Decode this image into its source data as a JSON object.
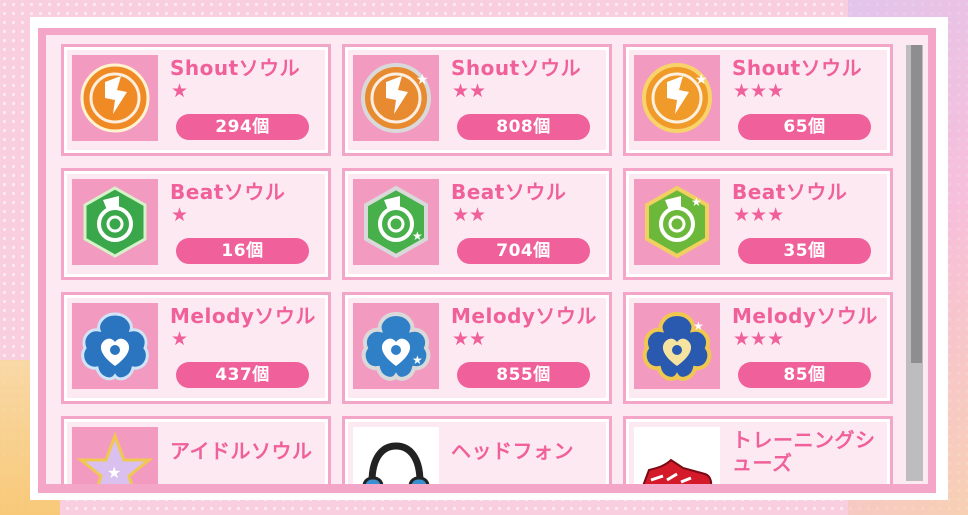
{
  "items": [
    {
      "name": "Shoutソウル",
      "stars": "★",
      "count": "294個",
      "icon": "shout-soul-icon",
      "color": "#f08a24"
    },
    {
      "name": "Shoutソウル",
      "stars": "★★",
      "count": "808個",
      "icon": "shout-soul-icon",
      "color": "#e88a30"
    },
    {
      "name": "Shoutソウル",
      "stars": "★★★",
      "count": "65個",
      "icon": "shout-soul-icon",
      "color": "#f09a2a"
    },
    {
      "name": "Beatソウル",
      "stars": "★",
      "count": "16個",
      "icon": "beat-soul-icon",
      "color": "#3aa84a"
    },
    {
      "name": "Beatソウル",
      "stars": "★★",
      "count": "704個",
      "icon": "beat-soul-icon",
      "color": "#48b04a"
    },
    {
      "name": "Beatソウル",
      "stars": "★★★",
      "count": "35個",
      "icon": "beat-soul-icon",
      "color": "#6cb83a"
    },
    {
      "name": "Melodyソウル",
      "stars": "★",
      "count": "437個",
      "icon": "melody-soul-icon",
      "color": "#2a74c0"
    },
    {
      "name": "Melodyソウル",
      "stars": "★★",
      "count": "855個",
      "icon": "melody-soul-icon",
      "color": "#3080c8"
    },
    {
      "name": "Melodyソウル",
      "stars": "★★★",
      "count": "85個",
      "icon": "melody-soul-icon",
      "color": "#2a5ab0"
    },
    {
      "name": "アイドルソウル",
      "stars": "",
      "count": "",
      "icon": "idol-soul-icon",
      "color": "#c8a0e0"
    },
    {
      "name": "ヘッドフォン",
      "stars": "",
      "count": "",
      "icon": "headphone-icon",
      "color": "#222222"
    },
    {
      "name": "トレーニングシューズ",
      "stars": "",
      "count": "",
      "icon": "training-shoes-icon",
      "color": "#d41a2a"
    }
  ],
  "theme": {
    "accent": "#f0609a",
    "panel": "#f4a6c8",
    "scroll_track": "#bdbdbd",
    "scroll_thumb": "#8e8e8e"
  }
}
